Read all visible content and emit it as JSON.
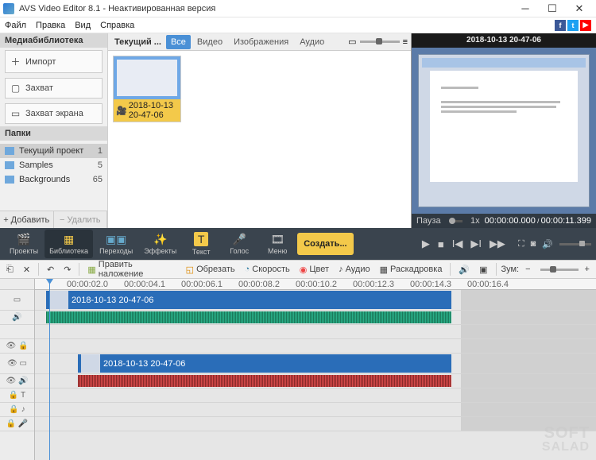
{
  "window": {
    "title": "AVS Video Editor 8.1 - Неактивированная версия"
  },
  "menu": {
    "file": "Файл",
    "edit": "Правка",
    "view": "Вид",
    "help": "Справка"
  },
  "sidebar": {
    "header": "Медиабиблиотека",
    "import": "Импорт",
    "capture": "Захват",
    "screen_capture": "Захват экрана",
    "folders_header": "Папки",
    "folders": [
      {
        "name": "Текущий проект",
        "count": "1"
      },
      {
        "name": "Samples",
        "count": "5"
      },
      {
        "name": "Backgrounds",
        "count": "65"
      }
    ],
    "add": "Добавить",
    "delete": "Удалить"
  },
  "media": {
    "group_label": "Текущий ...",
    "tabs": {
      "all": "Все",
      "video": "Видео",
      "images": "Изображения",
      "audio": "Аудио"
    },
    "item_caption": "2018-10-13 20-47-06"
  },
  "preview": {
    "title": "2018-10-13 20-47-06",
    "status": "Пауза",
    "speed": "1x",
    "time_current": "00:00:00.000",
    "time_total": "00:00:11.399"
  },
  "toolbar": {
    "projects": "Проекты",
    "library": "Библиотека",
    "transitions": "Переходы",
    "effects": "Эффекты",
    "text": "Текст",
    "voice": "Голос",
    "menu": "Меню",
    "create": "Создать..."
  },
  "edit": {
    "overlay": "Править наложение",
    "crop": "Обрезать",
    "speed": "Скорость",
    "color": "Цвет",
    "audio": "Аудио",
    "storyboard": "Раскадровка",
    "zoom": "Зум:"
  },
  "ruler": [
    "00:00:02.0",
    "00:00:04.1",
    "00:00:06.1",
    "00:00:08.2",
    "00:00:10.2",
    "00:00:12.3",
    "00:00:14.3",
    "00:00:16.4"
  ],
  "timeline": {
    "clip1": "2018-10-13 20-47-06",
    "clip2": "2018-10-13 20-47-06"
  },
  "watermark": {
    "l1": "SOFT",
    "l2": "SALAD"
  }
}
